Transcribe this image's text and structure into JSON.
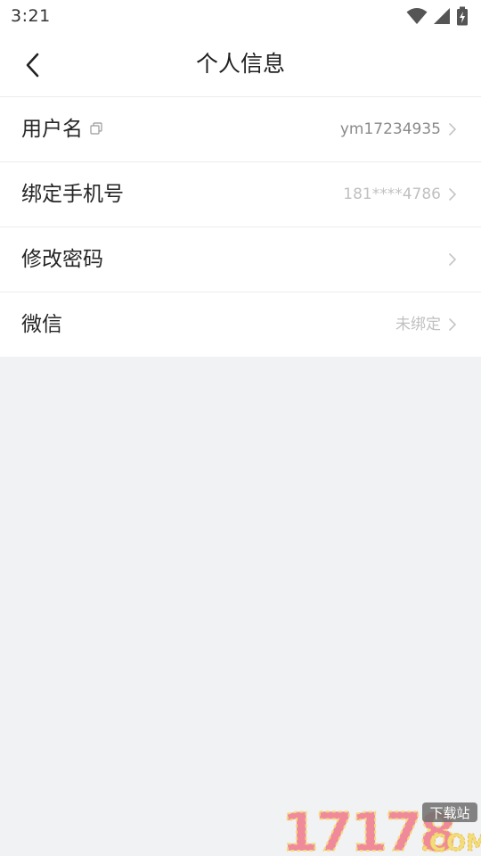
{
  "status_bar": {
    "time": "3:21",
    "icons": [
      "wifi-icon",
      "signal-icon",
      "battery-charging-icon"
    ]
  },
  "nav": {
    "title": "个人信息",
    "back_icon": "chevron-left-icon"
  },
  "rows": [
    {
      "label": "用户名",
      "value": "ym17234935",
      "has_copy_icon": true
    },
    {
      "label": "绑定手机号",
      "value": "181****4786"
    },
    {
      "label": "修改密码",
      "value": ""
    },
    {
      "label": "微信",
      "value": "未绑定"
    }
  ],
  "watermark": {
    "number_text": "17178",
    "badge_text": "下载站",
    "com_text": ".COM"
  },
  "colors": {
    "page_background": "#f1f2f4",
    "row_background": "#ffffff",
    "divider": "#ebebeb",
    "value_dark": "#8a8a8a",
    "value_light": "#c0c0c0",
    "watermark_pink": "#f08a9a",
    "watermark_yellow": "#f3dc7a"
  }
}
